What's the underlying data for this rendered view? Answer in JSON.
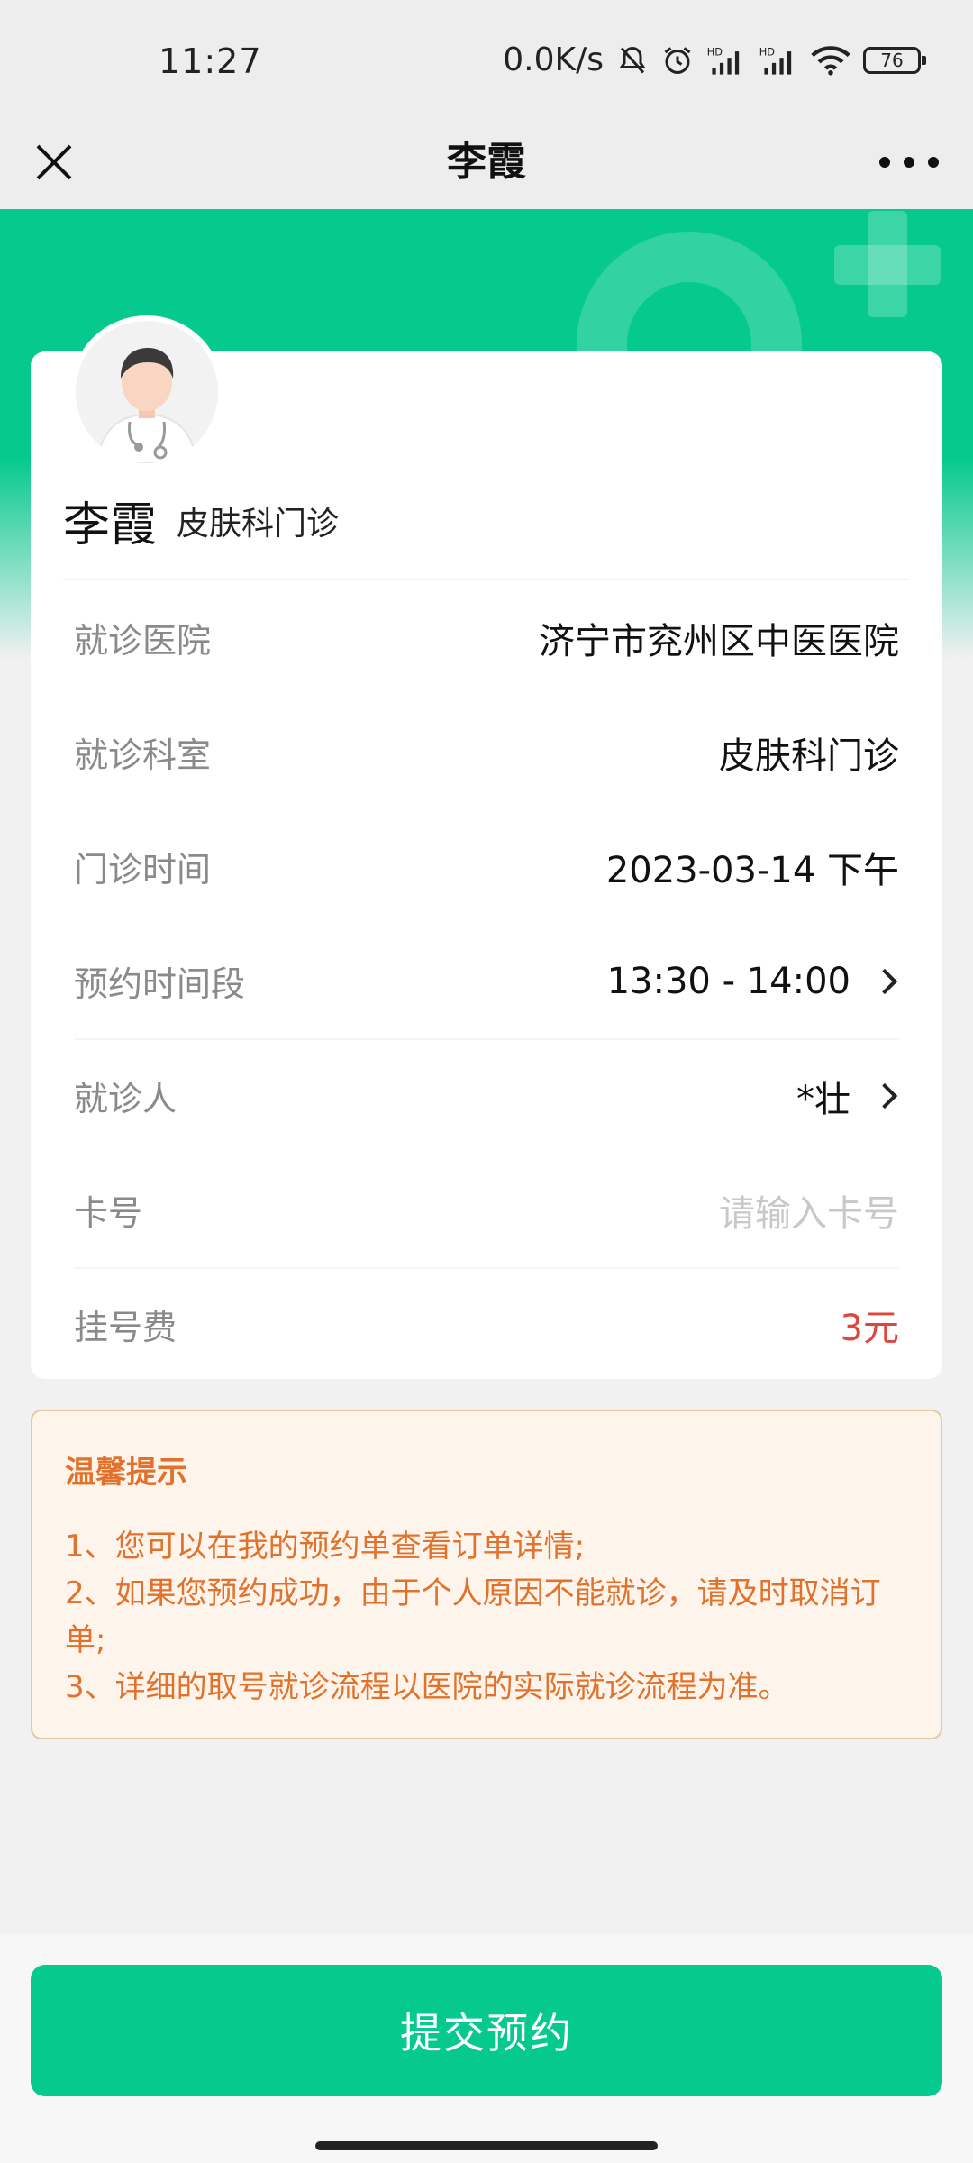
{
  "status_bar": {
    "time": "11:27",
    "net_speed": "0.0K/s",
    "battery": "76",
    "icons": [
      "mute-icon",
      "alarm-icon",
      "hd-signal-icon",
      "hd-signal-icon",
      "wifi-icon",
      "battery-icon"
    ]
  },
  "nav": {
    "title": "李霞",
    "close_icon": "close-icon",
    "more_icon": "more-icon"
  },
  "doctor": {
    "name": "李霞",
    "department": "皮肤科门诊"
  },
  "rows": [
    {
      "label": "就诊医院",
      "value": "济宁市兖州区中医医院",
      "type": "text"
    },
    {
      "label": "就诊科室",
      "value": "皮肤科门诊",
      "type": "text"
    },
    {
      "label": "门诊时间",
      "value": "2023-03-14 下午",
      "type": "text"
    },
    {
      "label": "预约时间段",
      "value": "13:30 - 14:00",
      "type": "select"
    },
    {
      "label": "就诊人",
      "value": "*壮",
      "type": "select"
    },
    {
      "label": "卡号",
      "value": "",
      "placeholder": "请输入卡号",
      "type": "input"
    },
    {
      "label": "挂号费",
      "value": "3元",
      "type": "price"
    }
  ],
  "notice": {
    "title": "温馨提示",
    "lines": [
      "1、您可以在我的预约单查看订单详情;",
      "2、如果您预约成功，由于个人原因不能就诊，请及时取消订单;",
      "3、详细的取号就诊流程以医院的实际就诊流程为准。"
    ]
  },
  "submit_label": "提交预约",
  "colors": {
    "brand": "#05c98e",
    "price": "#e0453b",
    "notice_text": "#e2722b",
    "notice_bg": "#fdf4ec"
  }
}
